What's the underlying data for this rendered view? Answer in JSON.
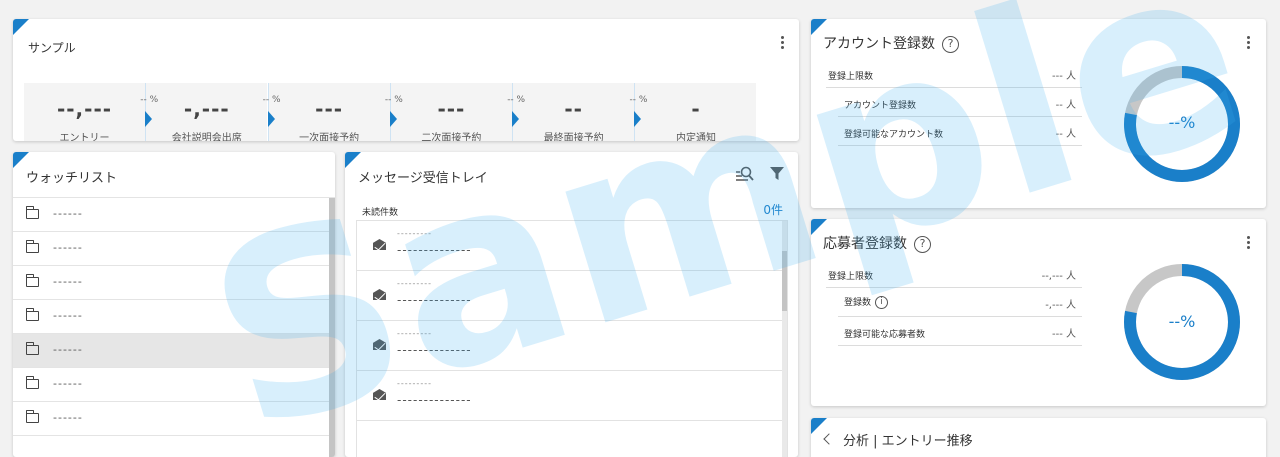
{
  "colors": {
    "accent": "#1a7fc9",
    "track": "#c7c7c7",
    "watermark": "#3cafef"
  },
  "sample_card": {
    "title": "サンプル",
    "steps": [
      {
        "value": "--,---",
        "label": "エントリー",
        "pct": ""
      },
      {
        "value": "-,---",
        "label": "会社説明会出席",
        "pct": "-- %"
      },
      {
        "value": "---",
        "label": "一次面接予約",
        "pct": "-- %"
      },
      {
        "value": "---",
        "label": "二次面接予約",
        "pct": "-- %"
      },
      {
        "value": "--",
        "label": "最終面接予約",
        "pct": "-- %"
      },
      {
        "value": "-",
        "label": "内定通知",
        "pct": "-- %"
      }
    ]
  },
  "watchlist": {
    "title": "ウォッチリスト",
    "items": [
      "------",
      "------",
      "------",
      "------",
      "------",
      "------",
      "------"
    ],
    "selected_index": 4
  },
  "inbox": {
    "title": "メッセージ受信トレイ",
    "unread_label": "未読件数",
    "unread_count": "0件",
    "messages": [
      {
        "sender": "---------",
        "subject": "--------------"
      },
      {
        "sender": "---------",
        "subject": "--------------"
      },
      {
        "sender": "---------",
        "subject": "--------------"
      },
      {
        "sender": "---------",
        "subject": "--------------"
      }
    ]
  },
  "account_card": {
    "title": "アカウント登録数",
    "help": "?",
    "rows": [
      {
        "label": "登録上限数",
        "value": "--- 人"
      },
      {
        "label": "アカウント登録数",
        "value": "-- 人"
      },
      {
        "label": "登録可能なアカウント数",
        "value": "-- 人"
      }
    ],
    "percent_text": "--%",
    "ring_fill": 0.78
  },
  "applicant_card": {
    "title": "応募者登録数",
    "help": "?",
    "info": "i",
    "rows": [
      {
        "label": "登録上限数",
        "value": "--,--- 人"
      },
      {
        "label": "登録数",
        "value": "-,--- 人"
      },
      {
        "label": "登録可能な応募者数",
        "value": "--- 人"
      }
    ],
    "percent_text": "--%",
    "ring_fill": 0.78
  },
  "bottom_card": {
    "title": "分析 | エントリー推移"
  },
  "watermark": "Sample"
}
